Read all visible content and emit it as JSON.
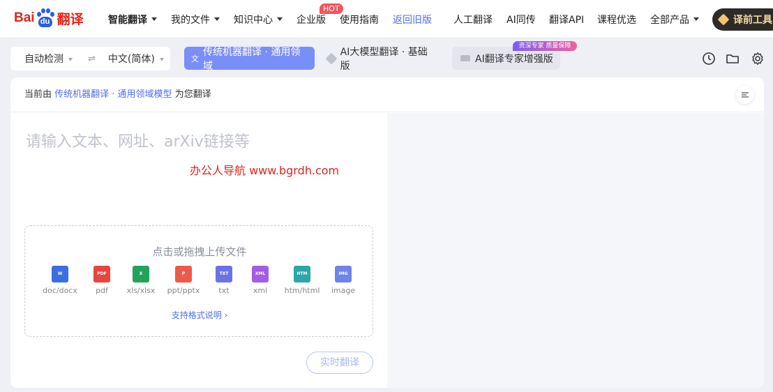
{
  "brand": {
    "logo_text_left": "Bai",
    "logo_paw_text": "du",
    "logo_text_right": "翻译"
  },
  "nav": {
    "items": [
      {
        "label": "智能翻译",
        "has_caret": true
      },
      {
        "label": "我的文件",
        "has_caret": true
      },
      {
        "label": "知识中心",
        "has_caret": true
      },
      {
        "label": "企业版",
        "has_caret": false
      },
      {
        "label": "使用指南",
        "has_caret": false
      },
      {
        "label": "返回旧版",
        "has_caret": false
      },
      {
        "label": "人工翻译",
        "has_caret": false
      },
      {
        "label": "AI同传",
        "has_caret": false
      },
      {
        "label": "翻译API",
        "has_caret": false
      },
      {
        "label": "课程优选",
        "has_caret": false
      },
      {
        "label": "全部产品",
        "has_caret": true
      }
    ],
    "hot_badge": "HOT",
    "tools_button": "译前工具"
  },
  "lang": {
    "source": "自动检测",
    "swap_icon": "swap-arrows-icon",
    "target": "中文(简体)"
  },
  "modes": {
    "mode1": "传统机器翻译 · 通用领域",
    "mode2": "AI大模型翻译 · 基础版",
    "mode3": "AI翻译专家增强版",
    "mode3_badge": "资深专家 质量保障"
  },
  "card": {
    "header_prefix": "当前由",
    "header_model": "传统机器翻译 · 通用领域模型",
    "header_suffix": "为您翻译",
    "input_placeholder": "请输入文本、网址、arXiv链接等",
    "watermark": "办公人导航  www.bgrdh.com"
  },
  "upload": {
    "title": "点击或拖拽上传文件",
    "file_types": [
      {
        "label": "doc/docx",
        "icon_text": "W",
        "color": "#3b6fe0"
      },
      {
        "label": "pdf",
        "icon_text": "PDF",
        "color": "#e8453c"
      },
      {
        "label": "xls/xlsx",
        "icon_text": "X",
        "color": "#23a35a"
      },
      {
        "label": "ppt/pptx",
        "icon_text": "P",
        "color": "#ee5a4a"
      },
      {
        "label": "txt",
        "icon_text": "TXT",
        "color": "#6b72e6"
      },
      {
        "label": "xml",
        "icon_text": "XML",
        "color": "#a45ce0"
      },
      {
        "label": "htm/html",
        "icon_text": "HTM",
        "color": "#2ca6a8"
      },
      {
        "label": "image",
        "icon_text": "IMG",
        "color": "#6f84e8"
      }
    ],
    "format_link": "支持格式说明 ›"
  },
  "realtime_button": "实时翻译",
  "colors": {
    "accent": "#4e6ef2",
    "brand_red": "#e1251b",
    "mode_active_bg": "#7a8ef8"
  }
}
